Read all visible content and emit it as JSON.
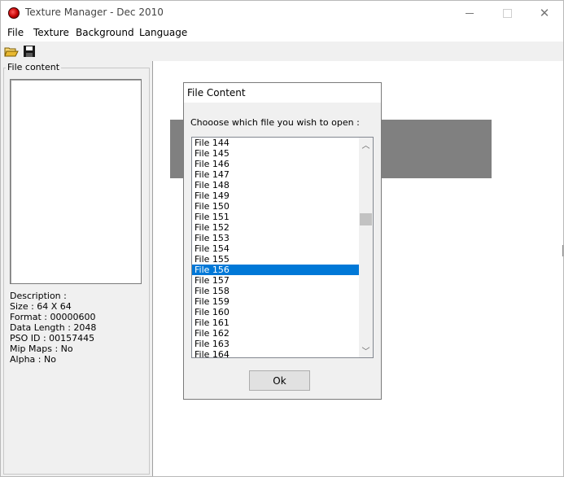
{
  "window": {
    "title": "Texture Manager - Dec 2010"
  },
  "menu": [
    "File",
    "Texture",
    "Background",
    "Language"
  ],
  "toolbar": {
    "open_icon": "open-folder-icon",
    "save_icon": "floppy-save-icon"
  },
  "left_panel": {
    "group_label": "File content",
    "info": [
      "Description :",
      "Size : 64 X 64",
      "Format : 00000600",
      "Data Length : 2048",
      "PSO ID : 00157445",
      "Mip Maps : No",
      "Alpha : No"
    ]
  },
  "dialog": {
    "title": "File Content",
    "prompt": "Chooose which file you wish to open :",
    "items": [
      "File 144",
      "File 145",
      "File 146",
      "File 147",
      "File 148",
      "File 149",
      "File 150",
      "File 151",
      "File 152",
      "File 153",
      "File 154",
      "File 155",
      "File 156",
      "File 157",
      "File 158",
      "File 159",
      "File 160",
      "File 161",
      "File 162",
      "File 163",
      "File 164"
    ],
    "selected": "File 156",
    "ok_label": "Ok"
  },
  "colors": {
    "selection": "#0078d7",
    "panel_bg": "#f0f0f0",
    "preview_grey": "#808080"
  }
}
